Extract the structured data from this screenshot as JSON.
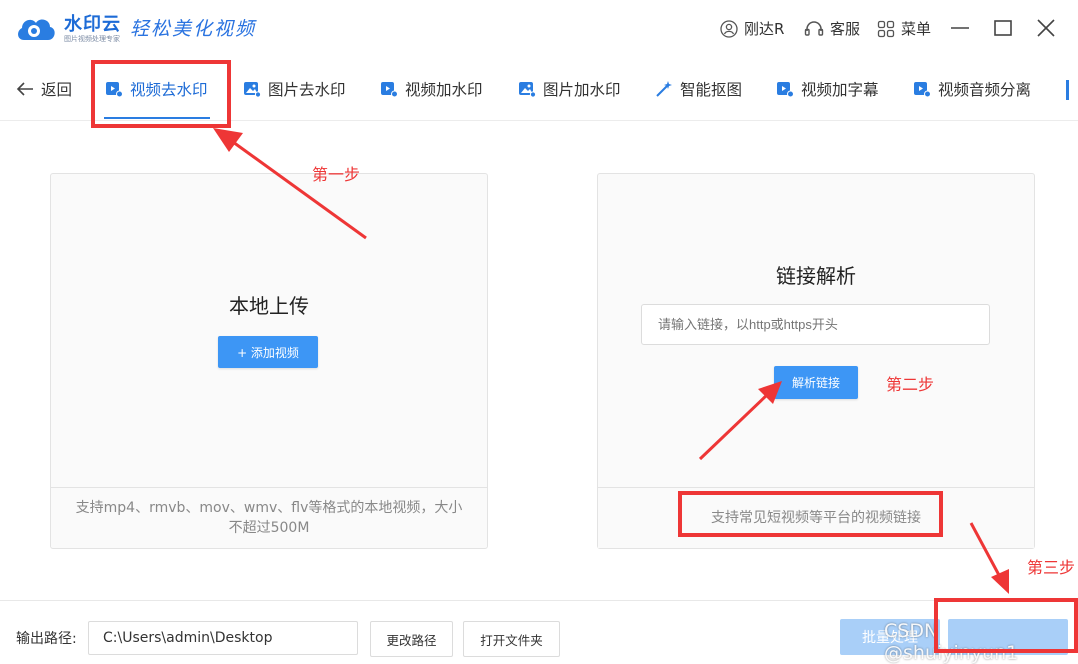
{
  "app": {
    "brand": "水印云",
    "brand_sub": "图片视频处理专家",
    "slogan": "轻松美化视频"
  },
  "titlebar": {
    "user": "刚达R",
    "service": "客服",
    "menu": "菜单"
  },
  "nav": {
    "back": "返回",
    "tabs": [
      {
        "label": "视频去水印",
        "icon": "video-icon",
        "active": true
      },
      {
        "label": "图片去水印",
        "icon": "image-icon"
      },
      {
        "label": "视频加水印",
        "icon": "video-icon"
      },
      {
        "label": "图片加水印",
        "icon": "image-icon"
      },
      {
        "label": "智能抠图",
        "icon": "magic-wand-icon"
      },
      {
        "label": "视频加字幕",
        "icon": "video-icon"
      },
      {
        "label": "视频音频分离",
        "icon": "video-icon"
      }
    ]
  },
  "local": {
    "title": "本地上传",
    "add_button": "+ 添加视频",
    "footer": "支持mp4、rmvb、mov、wmv、flv等格式的本地视频，大小不超过500M"
  },
  "link": {
    "title": "链接解析",
    "placeholder": "请输入链接，以http或https开头",
    "parse_button": "解析链接",
    "footer": "支持常见短视频等平台的视频链接"
  },
  "bottom": {
    "output_label": "输出路径:",
    "path": "C:\\Users\\admin\\Desktop",
    "change_button": "更改路径",
    "open_button": "打开文件夹",
    "batch_button": "批量处理",
    "watermark": "CSDN @shuiyinyun1"
  },
  "annotations": {
    "step1": "第一步",
    "step2": "第二步",
    "step3": "第三步"
  },
  "colors": {
    "accent": "#2a7de1",
    "button": "#3d96f5",
    "annotation": "#ee3636"
  }
}
